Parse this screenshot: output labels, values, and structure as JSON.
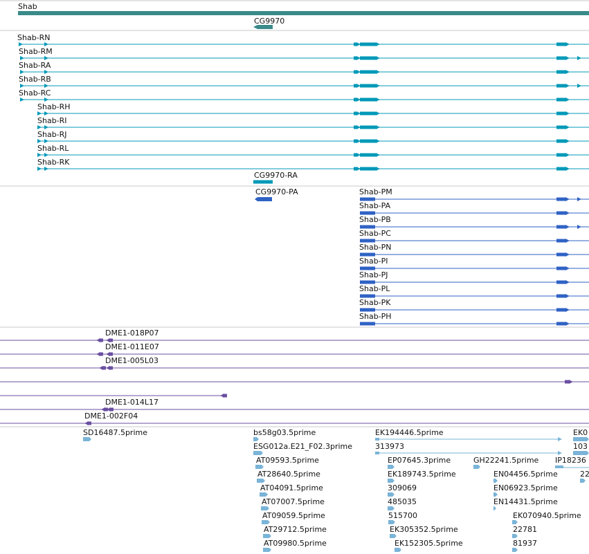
{
  "colors": {
    "gene": "#3a8a8a",
    "transcript": "#0099b8",
    "protein": "#2f62c4",
    "clone": "#6a4fa0",
    "est": "#7ab4d8",
    "separator": "#c8c8c8"
  },
  "gene_track": {
    "genes": [
      {
        "label": "Shab"
      },
      {
        "label": "CG9970"
      }
    ]
  },
  "transcript_track": {
    "rows": [
      {
        "label": "Shab-RN"
      },
      {
        "label": "Shab-RM"
      },
      {
        "label": "Shab-RA"
      },
      {
        "label": "Shab-RB"
      },
      {
        "label": "Shab-RC"
      },
      {
        "label": "Shab-RH"
      },
      {
        "label": "Shab-RI"
      },
      {
        "label": "Shab-RJ"
      },
      {
        "label": "Shab-RL"
      },
      {
        "label": "Shab-RK"
      },
      {
        "label": "CG9970-RA"
      }
    ]
  },
  "protein_track": {
    "rows": [
      {
        "label": "CG9970-PA"
      },
      {
        "label": "Shab-PM"
      },
      {
        "label": "Shab-PA"
      },
      {
        "label": "Shab-PB"
      },
      {
        "label": "Shab-PC"
      },
      {
        "label": "Shab-PN"
      },
      {
        "label": "Shab-PI"
      },
      {
        "label": "Shab-PJ"
      },
      {
        "label": "Shab-PL"
      },
      {
        "label": "Shab-PK"
      },
      {
        "label": "Shab-PH"
      }
    ]
  },
  "clone_track": {
    "rows": [
      {
        "label": "DME1-018P07"
      },
      {
        "label": "DME1-011E07"
      },
      {
        "label": "DME1-005L03"
      },
      {
        "label": ""
      },
      {
        "label": ""
      },
      {
        "label": "DME1-014L17"
      },
      {
        "label": "DME1-002F04"
      }
    ]
  },
  "est_track": {
    "items": [
      {
        "label": "SD16487.5prime"
      },
      {
        "label": "bs58g03.5prime"
      },
      {
        "label": "ESG012a.E21_F02.3prime"
      },
      {
        "label": "AT09593.5prime"
      },
      {
        "label": "AT28640.5prime"
      },
      {
        "label": "AT04091.5prime"
      },
      {
        "label": "AT07007.5prime"
      },
      {
        "label": "AT09059.5prime"
      },
      {
        "label": "AT29712.5prime"
      },
      {
        "label": "AT09980.5prime"
      },
      {
        "label": "EK194446.5prime"
      },
      {
        "label": "313973"
      },
      {
        "label": "EP07645.3prime"
      },
      {
        "label": "EK189743.5prime"
      },
      {
        "label": "309069"
      },
      {
        "label": "485035"
      },
      {
        "label": "515700"
      },
      {
        "label": "EK305352.5prime"
      },
      {
        "label": "EK152305.5prime"
      },
      {
        "label": "GH22241.5prime"
      },
      {
        "label": "EN04456.5prime"
      },
      {
        "label": "EN06923.5prime"
      },
      {
        "label": "EN14431.5prime"
      },
      {
        "label": "EK070940.5prime"
      },
      {
        "label": "22781"
      },
      {
        "label": "81937"
      },
      {
        "label": "EK0"
      },
      {
        "label": "103"
      },
      {
        "label": "IP18236"
      },
      {
        "label": "22"
      }
    ]
  }
}
